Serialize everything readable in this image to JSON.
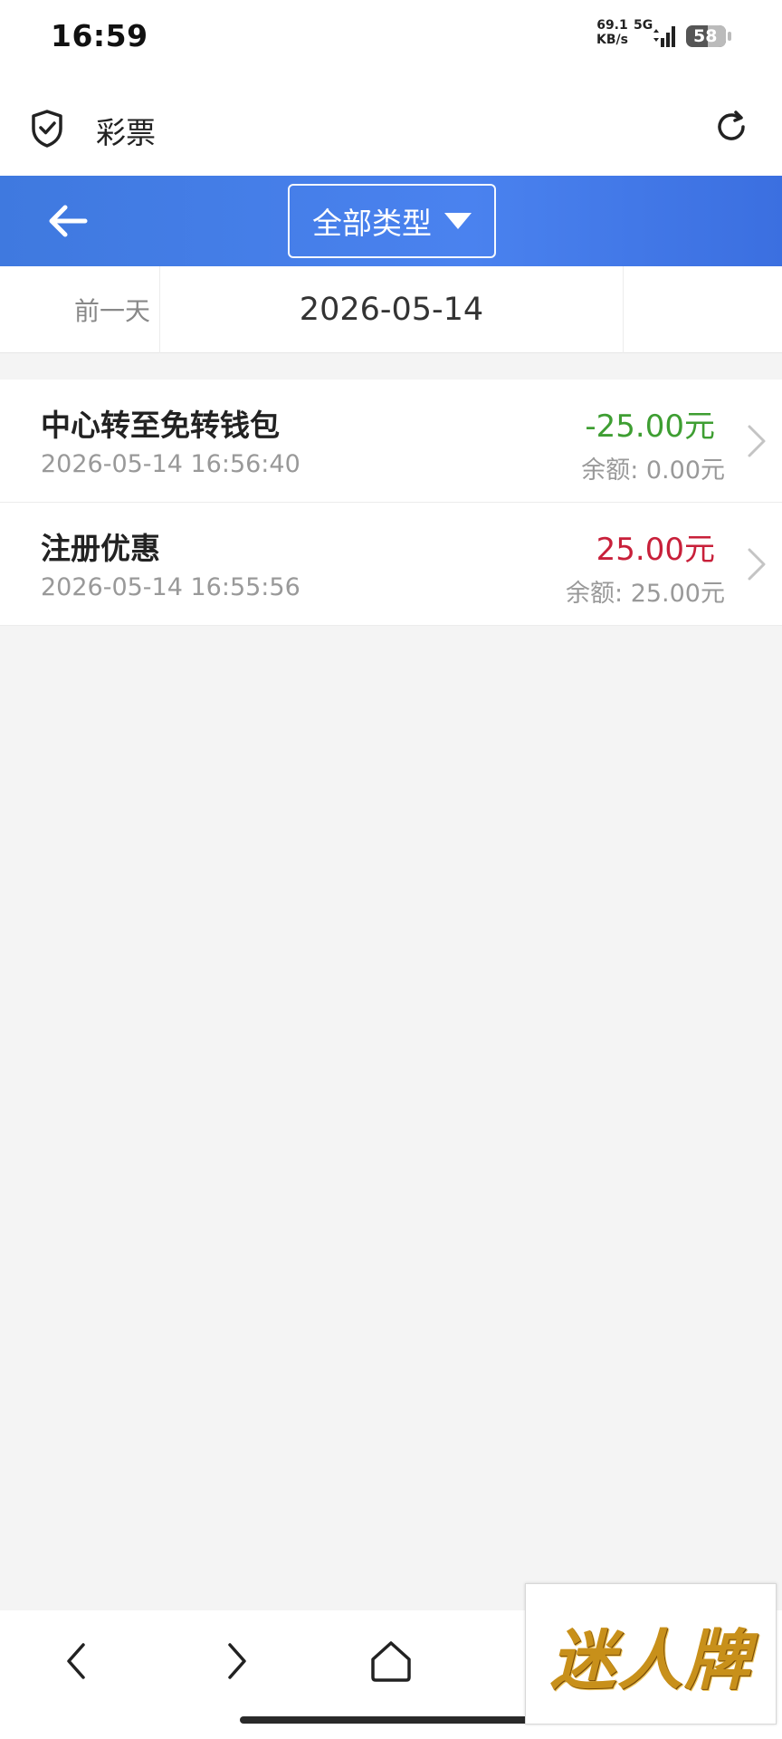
{
  "status_bar": {
    "time": "16:59",
    "net_speed_value": "69.1",
    "net_speed_unit": "KB/s",
    "network": "5G",
    "battery": "58"
  },
  "browser": {
    "title": "彩票",
    "shield_icon": "shield-check-icon",
    "refresh_icon": "refresh-icon"
  },
  "app_bar": {
    "type_select_label": "全部类型",
    "accent": "#4a82ef"
  },
  "date_nav": {
    "prev_label": "前一天",
    "current_date": "2026-05-14"
  },
  "transactions": [
    {
      "title": "中心转至免转钱包",
      "time": "2026-05-14 16:56:40",
      "amount": "-25.00元",
      "balance": "余额: 0.00元",
      "amount_color": "#3e9e32"
    },
    {
      "title": "注册优惠",
      "time": "2026-05-14 16:55:56",
      "amount": "25.00元",
      "balance": "余额: 25.00元",
      "amount_color": "#c8203a"
    }
  ],
  "watermark": {
    "text": "迷人牌"
  }
}
